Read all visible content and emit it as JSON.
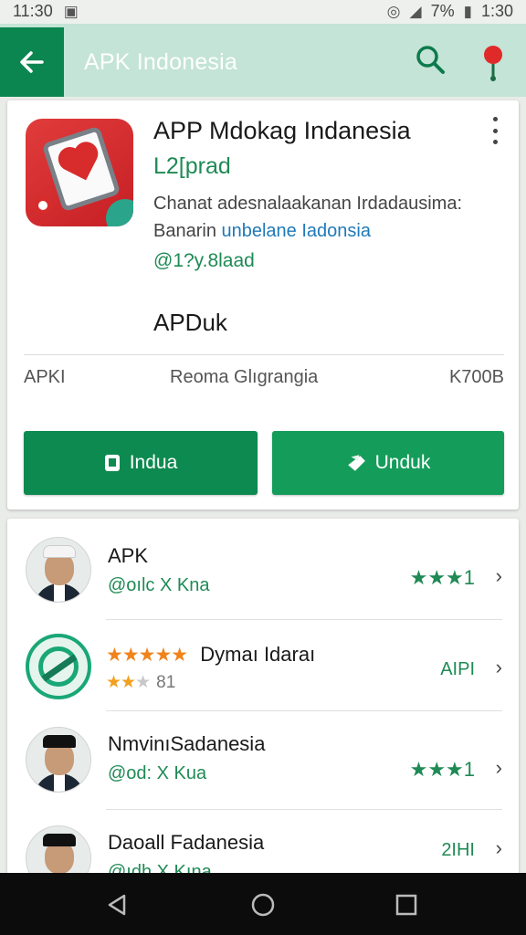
{
  "status_bar": {
    "time_left": "11:30",
    "battery": "7%",
    "time_right": "1:30",
    "icons": [
      "image-icon",
      "alarm-icon",
      "signal-icon",
      "battery-icon"
    ]
  },
  "app_bar": {
    "title": "APK Indonesia",
    "icons": [
      "back-arrow-icon",
      "search-icon",
      "location-pin-icon"
    ]
  },
  "app": {
    "title": "APP Mdokag Indanesia",
    "subtitle": "L2[prad",
    "description_line1": "Chanat adesnalaakanan Irdadausima:",
    "description_line2_plain": "Banarin ",
    "description_line2_link": "unbelane Iadonsia",
    "handle": "@1?y.8laad",
    "type": "APDuk",
    "meta_left": "APKI",
    "meta_mid": "Reoma Glıgrangia",
    "meta_right": "K700B",
    "install_label": "Indua",
    "download_label": "Unduk"
  },
  "list": [
    {
      "title": "APK",
      "subtitle": "@oılc X Kna",
      "right": "★★★1",
      "avatar": "man-white-cap"
    },
    {
      "title": "Dymaı Idaraı",
      "stars": "★★★★★",
      "rating_stars_filled": "★★",
      "rating_stars_empty": "★",
      "rating_number": "81",
      "right": "AIPI",
      "avatar": "green-badge"
    },
    {
      "title": "NmvinıSadanesia",
      "subtitle": "@od: X Kua",
      "right": "★★★1",
      "avatar": "man-black-cap"
    },
    {
      "title": "Daoall Fadanesia",
      "subtitle": "@ıdh X Kına",
      "right": "2IHI",
      "avatar": "man-black-cap"
    }
  ],
  "colors": {
    "accent": "#0c8650",
    "app_bar": "#c3e4d6",
    "link": "#1f79b8",
    "star_gold": "#f0831c"
  }
}
